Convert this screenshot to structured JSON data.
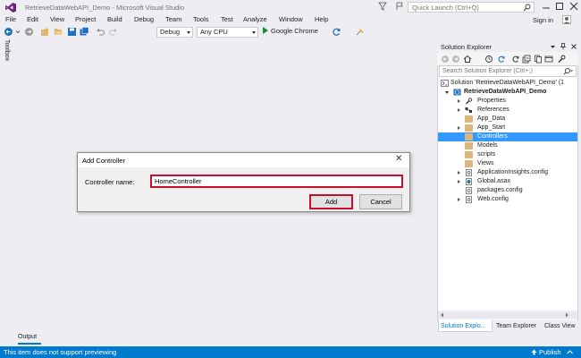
{
  "window": {
    "title": "RetrieveDataWebAPI_Demo - Microsoft Visual Studio",
    "quick_launch_placeholder": "Quick Launch (Ctrl+Q)",
    "sign_in": "Sign in"
  },
  "menu": {
    "items": [
      "File",
      "Edit",
      "View",
      "Project",
      "Build",
      "Debug",
      "Team",
      "Tools",
      "Test",
      "Analyze",
      "Window",
      "Help"
    ]
  },
  "toolbar": {
    "config": "Debug",
    "platform": "Any CPU",
    "run_target": "Google Chrome"
  },
  "toolbox": {
    "label": "Toolbox"
  },
  "solution_explorer": {
    "title": "Solution Explorer",
    "search_placeholder": "Search Solution Explorer (Ctrl+;)",
    "tree": [
      {
        "label": "Solution 'RetrieveDataWebAPI_Demo' (1",
        "icon": "solution-icon"
      },
      {
        "label": "RetrieveDataWebAPI_Demo",
        "icon": "web-project-icon"
      },
      {
        "label": "Properties",
        "icon": "wrench-icon"
      },
      {
        "label": "References",
        "icon": "references-icon"
      },
      {
        "label": "App_Data",
        "icon": "folder-icon"
      },
      {
        "label": "App_Start",
        "icon": "folder-icon"
      },
      {
        "label": "Controllers",
        "icon": "folder-icon"
      },
      {
        "label": "Models",
        "icon": "folder-icon"
      },
      {
        "label": "scripts",
        "icon": "folder-icon"
      },
      {
        "label": "Views",
        "icon": "folder-icon"
      },
      {
        "label": "ApplicationInsights.config",
        "icon": "config-file-icon"
      },
      {
        "label": "Global.asax",
        "icon": "asax-file-icon"
      },
      {
        "label": "packages.config",
        "icon": "config-file-icon"
      },
      {
        "label": "Web.config",
        "icon": "config-file-icon"
      }
    ],
    "tabs": [
      "Solution Explo...",
      "Team Explorer",
      "Class View"
    ]
  },
  "output": {
    "tab": "Output"
  },
  "statusbar": {
    "message": "This item does not support previewing",
    "publish": "Publish"
  },
  "dialog": {
    "title": "Add Controller",
    "field_label": "Controller name:",
    "field_value": "HomeController",
    "add_label": "Add",
    "cancel_label": "Cancel"
  },
  "colors": {
    "accent": "#007acc",
    "selection": "#3399ff",
    "highlight_border": "#c8102e"
  }
}
